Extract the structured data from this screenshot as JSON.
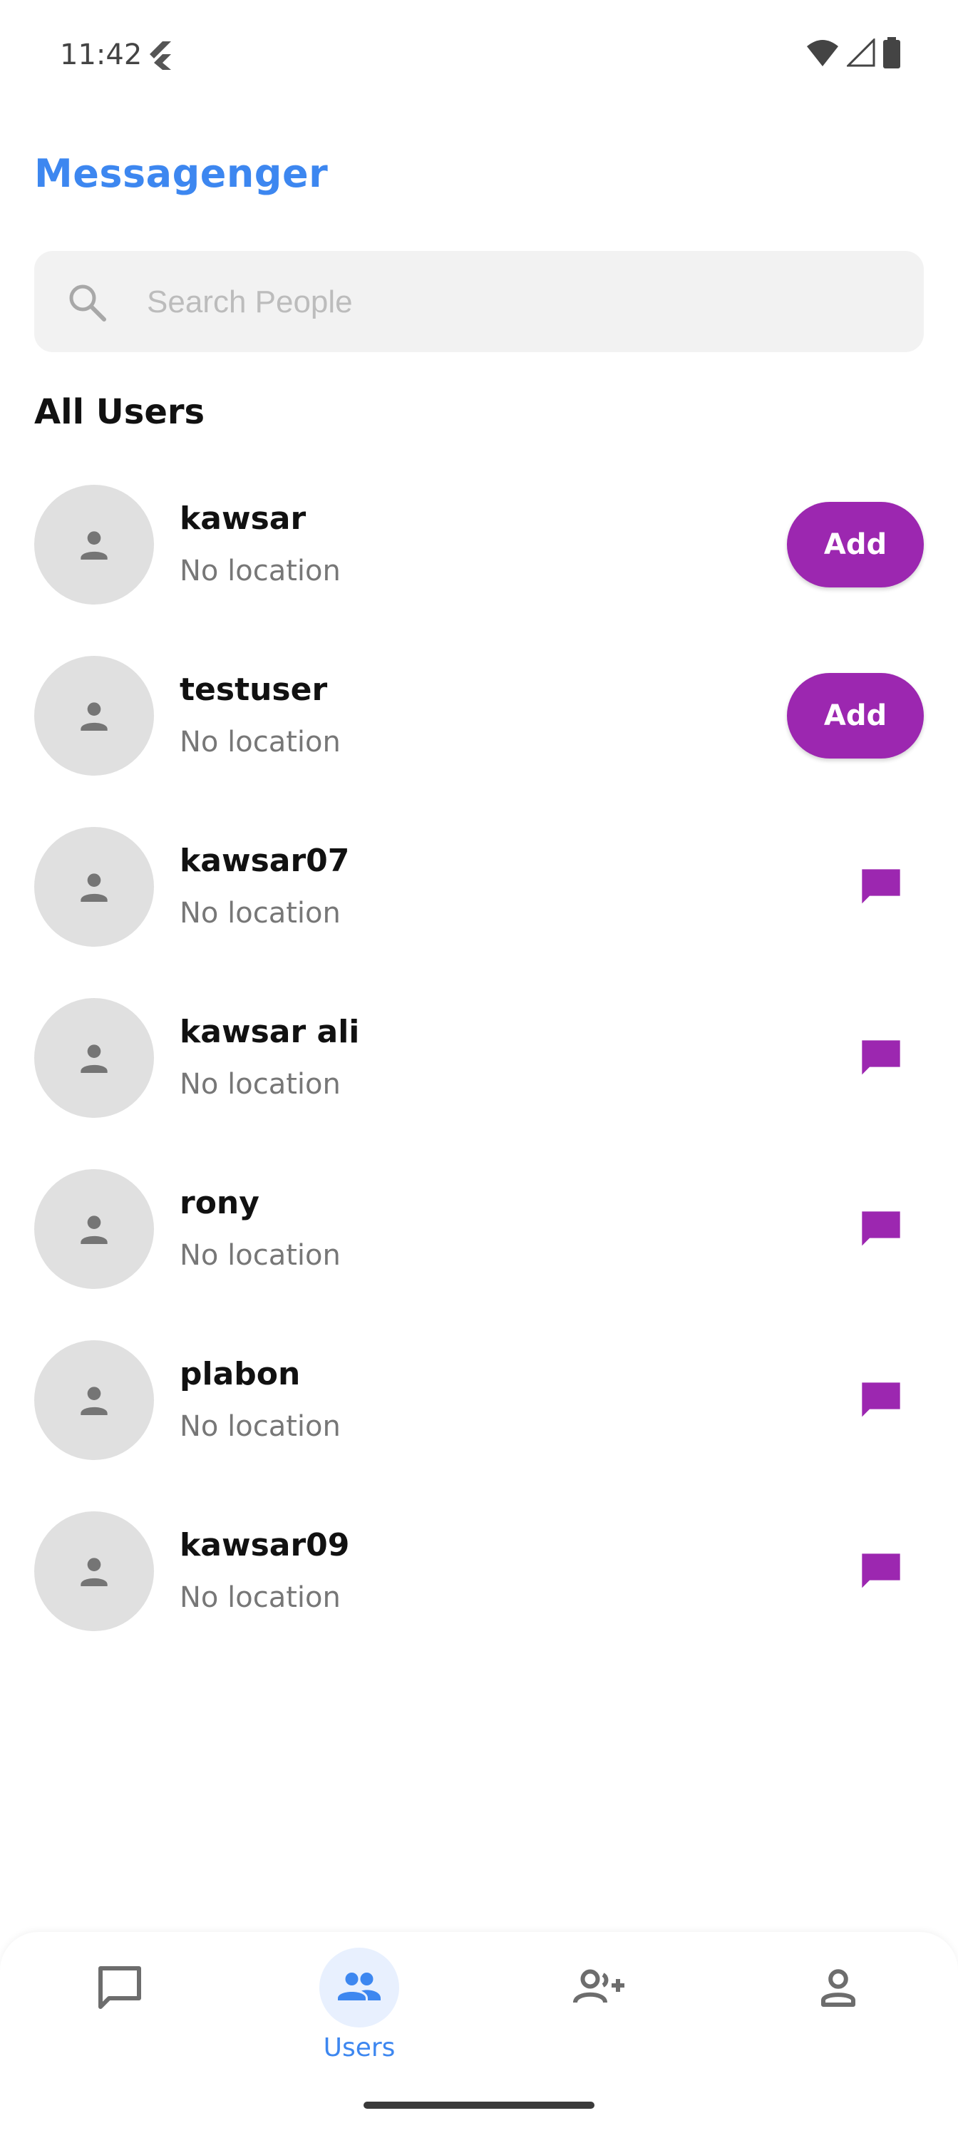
{
  "status_bar": {
    "time": "11:42",
    "icons": [
      "flutter-icon",
      "wifi-icon",
      "signal-icon",
      "battery-icon"
    ]
  },
  "header": {
    "title": "Messagenger",
    "title_color": "#3d87f0"
  },
  "search": {
    "placeholder": "Search People",
    "value": ""
  },
  "section": {
    "title": "All Users"
  },
  "users": [
    {
      "name": "kawsar",
      "location": "No location",
      "action": "Add"
    },
    {
      "name": "testuser",
      "location": "No location",
      "action": "Add"
    },
    {
      "name": "kawsar07",
      "location": "No location",
      "action": "message"
    },
    {
      "name": "kawsar ali",
      "location": "No location",
      "action": "message"
    },
    {
      "name": "rony",
      "location": "No location",
      "action": "message"
    },
    {
      "name": "plabon",
      "location": "No location",
      "action": "message"
    },
    {
      "name": "kawsar09",
      "location": "No location",
      "action": "message"
    }
  ],
  "bottom_nav": {
    "items": [
      {
        "icon": "chat-icon",
        "label": "",
        "active": false
      },
      {
        "icon": "users-icon",
        "label": "Users",
        "active": true
      },
      {
        "icon": "add-user-icon",
        "label": "",
        "active": false
      },
      {
        "icon": "profile-icon",
        "label": "",
        "active": false
      }
    ]
  },
  "colors": {
    "accent_blue": "#3d87f0",
    "purple": "#9c27b0",
    "avatar_bg": "#e0e0e0",
    "search_bg": "#f2f2f2"
  }
}
